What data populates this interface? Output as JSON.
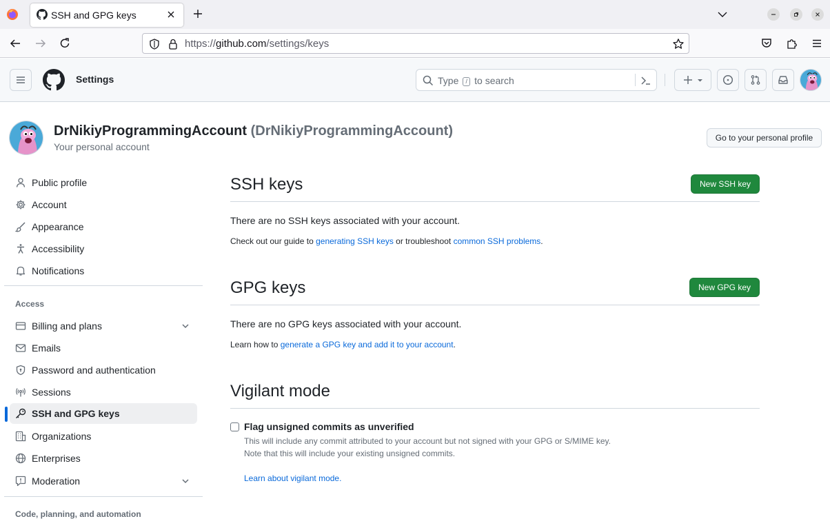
{
  "browser": {
    "tab_title": "SSH and GPG keys",
    "url_prefix": "https://",
    "url_host": "github.com",
    "url_path": "/settings/keys"
  },
  "header": {
    "context": "Settings",
    "search_placeholder_before": "Type",
    "search_kbd": "/",
    "search_placeholder_after": "to search"
  },
  "account": {
    "display_name": "DrNikiyProgrammingAccount",
    "login": "(DrNikiyProgrammingAccount)",
    "subtitle": "Your personal account",
    "profile_button": "Go to your personal profile"
  },
  "sidebar": {
    "items": [
      {
        "label": "Public profile",
        "icon": "person-icon"
      },
      {
        "label": "Account",
        "icon": "gear-icon"
      },
      {
        "label": "Appearance",
        "icon": "paintbrush-icon"
      },
      {
        "label": "Accessibility",
        "icon": "accessibility-icon"
      },
      {
        "label": "Notifications",
        "icon": "bell-icon"
      }
    ],
    "access_heading": "Access",
    "access_items": [
      {
        "label": "Billing and plans",
        "icon": "credit-card-icon"
      },
      {
        "label": "Emails",
        "icon": "mail-icon"
      },
      {
        "label": "Password and authentication",
        "icon": "shield-lock-icon"
      },
      {
        "label": "Sessions",
        "icon": "broadcast-icon"
      },
      {
        "label": "SSH and GPG keys",
        "icon": "key-icon"
      },
      {
        "label": "Organizations",
        "icon": "organization-icon"
      },
      {
        "label": "Enterprises",
        "icon": "globe-icon"
      },
      {
        "label": "Moderation",
        "icon": "report-icon"
      }
    ],
    "code_heading": "Code, planning, and automation"
  },
  "ssh": {
    "title": "SSH keys",
    "button": "New SSH key",
    "empty": "There are no SSH keys associated with your account.",
    "guide_prefix": "Check out our guide to",
    "guide_link1": "generating SSH keys",
    "guide_middle": "or troubleshoot",
    "guide_link2": "common SSH problems",
    "guide_suffix": "."
  },
  "gpg": {
    "title": "GPG keys",
    "button": "New GPG key",
    "empty": "There are no GPG keys associated with your account.",
    "learn_prefix": "Learn how to",
    "learn_link": "generate a GPG key and add it to your account",
    "learn_suffix": "."
  },
  "vigilant": {
    "title": "Vigilant mode",
    "checkbox_label": "Flag unsigned commits as unverified",
    "note1": "This will include any commit attributed to your account but not signed with your GPG or S/MIME key.",
    "note2": "Note that this will include your existing unsigned commits.",
    "learn_link": "Learn about vigilant mode."
  },
  "colors": {
    "primary_green": "#1f883d",
    "link_blue": "#0969da",
    "active_indicator": "#0969da"
  }
}
